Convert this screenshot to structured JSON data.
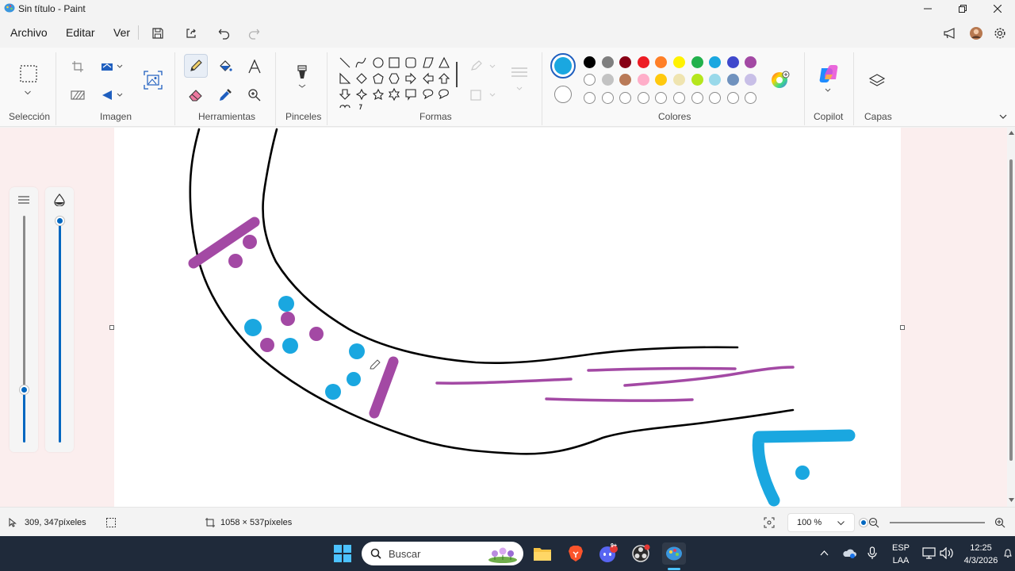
{
  "titlebar": {
    "title": "Sin título - Paint"
  },
  "menu": {
    "file": "Archivo",
    "edit": "Editar",
    "view": "Ver"
  },
  "ribbon": {
    "groups": {
      "selection": "Selección",
      "image": "Imagen",
      "tools": "Herramientas",
      "brushes": "Pinceles",
      "shapes": "Formas",
      "colors": "Colores",
      "copilot": "Copilot",
      "layers": "Capas"
    },
    "active_color": "#1aa7e0",
    "palette_row1": [
      "#000000",
      "#7f7f7f",
      "#880015",
      "#ed1c24",
      "#ff7f27",
      "#fff200",
      "#22b14c",
      "#1aa7e0",
      "#3f48cc",
      "#a349a4"
    ],
    "palette_row2": [
      "#ffffff",
      "#c3c3c3",
      "#b97a57",
      "#ffaec9",
      "#ffc90e",
      "#efe4b0",
      "#b5e61d",
      "#99d9ea",
      "#7092be",
      "#c8bfe7"
    ]
  },
  "canvas": {
    "stroke_color": "#000000",
    "purple": "#a349a4",
    "blue": "#1aa7e0"
  },
  "statusbar": {
    "cursor_pos": "309, 347píxeles",
    "canvas_size": "1058 × 537píxeles",
    "zoom": "100 %",
    "zoom_level": 0.6
  },
  "taskbar": {
    "search_placeholder": "Buscar",
    "language": "ESP",
    "layout": "LAA",
    "time": "12:25",
    "date": "4/3/2026",
    "discord_badge": "9+"
  }
}
